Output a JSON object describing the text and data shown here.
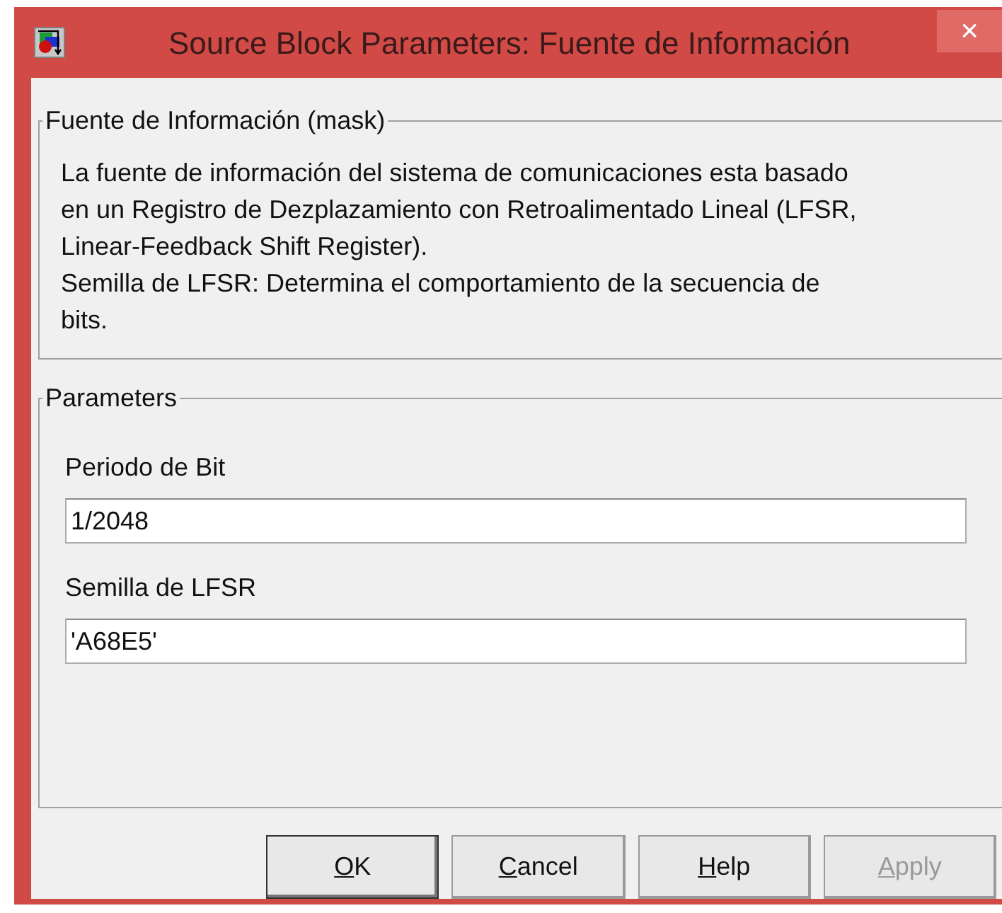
{
  "window": {
    "title": "Source Block Parameters: Fuente de Información",
    "close": "×"
  },
  "mask_group": {
    "title": "Fuente de Información (mask)",
    "lines": [
      "La fuente de información del sistema de comunicaciones esta basado",
      "en un Registro de Dezplazamiento con Retroalimentado Lineal (LFSR,",
      "Linear-Feedback Shift Register).",
      "Semilla de LFSR: Determina el comportamiento de la secuencia de",
      "bits."
    ]
  },
  "parameters_group": {
    "title": "Parameters",
    "fields": [
      {
        "label": "Periodo de Bit",
        "value": "1/2048"
      },
      {
        "label": "Semilla de LFSR",
        "value": "'A68E5'"
      }
    ]
  },
  "buttons": [
    {
      "mnemonic": "O",
      "rest": "K",
      "default": true,
      "disabled": false
    },
    {
      "mnemonic": "C",
      "rest": "ancel",
      "default": false,
      "disabled": false
    },
    {
      "mnemonic": "H",
      "rest": "elp",
      "default": false,
      "disabled": false
    },
    {
      "mnemonic": "A",
      "rest": "pply",
      "default": false,
      "disabled": true
    }
  ]
}
